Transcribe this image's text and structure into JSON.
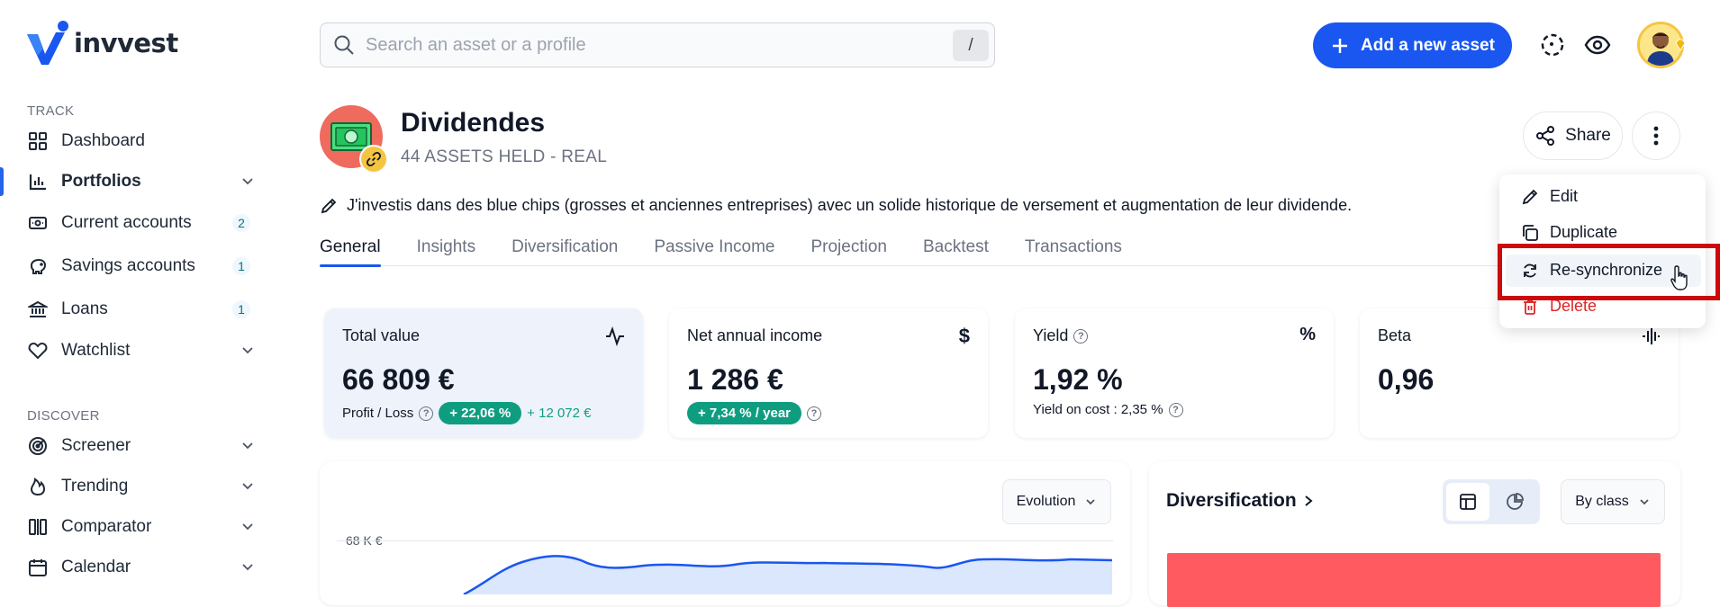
{
  "brand": {
    "name": "invvest"
  },
  "sidebar": {
    "track_label": "TRACK",
    "discover_label": "DISCOVER",
    "items": [
      {
        "label": "Dashboard"
      },
      {
        "label": "Portfolios"
      },
      {
        "label": "Current accounts",
        "count": "2"
      },
      {
        "label": "Savings accounts",
        "count": "1"
      },
      {
        "label": "Loans",
        "count": "1"
      },
      {
        "label": "Watchlist"
      }
    ],
    "discover_items": [
      {
        "label": "Screener"
      },
      {
        "label": "Trending"
      },
      {
        "label": "Comparator"
      },
      {
        "label": "Calendar"
      }
    ]
  },
  "topbar": {
    "search_placeholder": "Search an asset or a profile",
    "search_shortcut": "/",
    "add_label": "Add a new asset"
  },
  "portfolio": {
    "title": "Dividendes",
    "subtitle": "44 ASSETS HELD - REAL",
    "description": "J'investis dans des blue chips (grosses et anciennes entreprises) avec un solide historique de versement et augmentation de leur dividende.",
    "share_label": "Share"
  },
  "tabs": [
    "General",
    "Insights",
    "Diversification",
    "Passive Income",
    "Projection",
    "Backtest",
    "Transactions"
  ],
  "cards": {
    "total_value": {
      "title": "Total value",
      "value": "66 809 €",
      "foot_label": "Profit / Loss",
      "pill": "+ 22,06 %",
      "gain": "+ 12 072 €"
    },
    "net_income": {
      "title": "Net annual income",
      "value": "1 286 €",
      "pill": "+ 7,34 % / year",
      "icon_text": "$"
    },
    "yield": {
      "title": "Yield",
      "value": "1,92 %",
      "foot": "Yield on cost : 2,35 %",
      "icon_text": "%"
    },
    "beta": {
      "title": "Beta",
      "value": "0,96"
    }
  },
  "chart_panel": {
    "select_label": "Evolution",
    "y_tick": "68 K €"
  },
  "diversification_panel": {
    "title": "Diversification",
    "select_label": "By class"
  },
  "menu": {
    "items": [
      {
        "label": "Edit"
      },
      {
        "label": "Duplicate"
      },
      {
        "label": "Re-synchronize"
      },
      {
        "label": "Delete"
      }
    ]
  },
  "colors": {
    "accent": "#1a56f0",
    "positive": "#0f9d80",
    "danger": "#dc2626",
    "highlight_box": "#cc0a0a"
  }
}
